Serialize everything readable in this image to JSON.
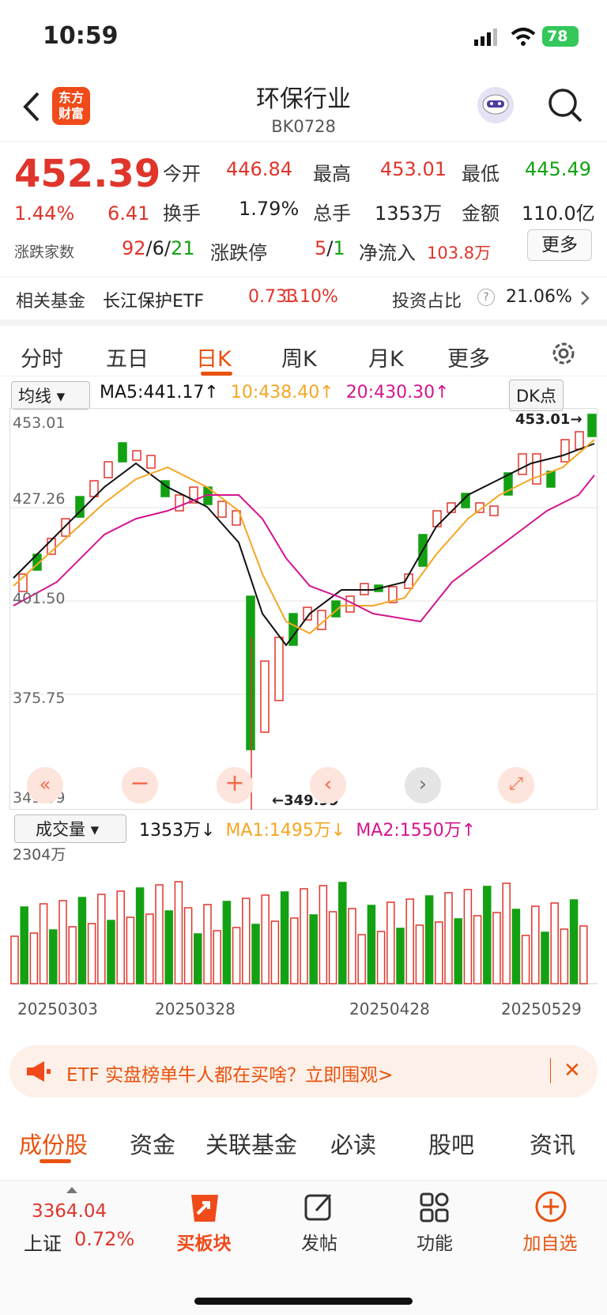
{
  "status": {
    "time": "10:59",
    "battery": "78"
  },
  "header": {
    "title": "环保行业",
    "code": "BK0728",
    "logo": "东方\n财富"
  },
  "quote": {
    "price": "452.39",
    "pct": "1.44%",
    "chg": "6.41",
    "open_label": "今开",
    "open": "446.84",
    "high_label": "最高",
    "high": "453.01",
    "low_label": "最低",
    "low": "445.49",
    "turn_label": "换手",
    "turn": "1.79%",
    "vol_label": "总手",
    "vol": "1353万",
    "amt_label": "金额",
    "amt": "110.0亿",
    "breadth_label": "涨跌家数",
    "up": "92",
    "flat": "6",
    "down": "21",
    "limit_label": "涨跌停",
    "limit_up": "5",
    "limit_down": "1",
    "flow_label": "净流入",
    "flow": "103.8万",
    "more": "更多"
  },
  "fund": {
    "label": "相关基金",
    "name": "长江保护ETF",
    "price": "0.733",
    "pct": "1.10%",
    "ratio_label": "投资占比",
    "ratio": "21.06%"
  },
  "tabs": [
    "分时",
    "五日",
    "日K",
    "周K",
    "月K",
    "更多"
  ],
  "kline": {
    "ma_select": "均线",
    "ma5": "MA5:441.17",
    "ma10": "10:438.40",
    "ma20": "20:430.30",
    "dk": "DK点",
    "y_labels": [
      "453.01",
      "427.26",
      "401.50",
      "375.75",
      "349.99"
    ],
    "hi_mark": "453.01→",
    "lo_mark": "←349.99"
  },
  "vol": {
    "select": "成交量",
    "value": "1353万",
    "ma1": "MA1:1495万",
    "ma2": "MA2:1550万",
    "y_label": "2304万",
    "dates": [
      "20250303",
      "20250328",
      "20250428",
      "20250529"
    ]
  },
  "banner": {
    "text": "ETF 实盘榜单牛人都在买啥？立即围观>"
  },
  "sections": [
    "成份股",
    "资金",
    "关联基金",
    "必读",
    "股吧",
    "资讯"
  ],
  "bottom": {
    "index_val": "3364.04",
    "index_name": "上证",
    "index_pct": "0.72%",
    "items": [
      "买板块",
      "发帖",
      "功能",
      "加自选"
    ]
  },
  "colors": {
    "up": "#e0352b",
    "down": "#13a113",
    "ma5": "#111111",
    "ma10": "#f5a623",
    "ma20": "#d4148f",
    "accent": "#e8520e"
  }
}
